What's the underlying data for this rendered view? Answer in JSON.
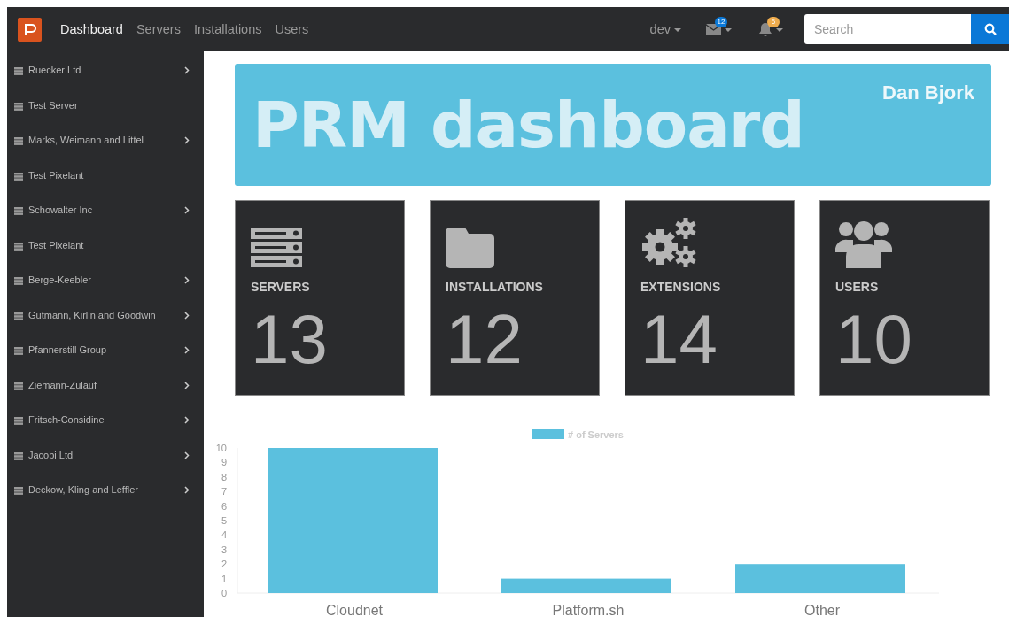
{
  "navbar": {
    "nav_items": [
      {
        "label": "Dashboard",
        "selected": true
      },
      {
        "label": "Servers",
        "selected": false
      },
      {
        "label": "Installations",
        "selected": false
      },
      {
        "label": "Users",
        "selected": false
      }
    ],
    "user_menu": "dev",
    "messages_badge": "12",
    "notifications_badge": "6",
    "search": {
      "placeholder": "Search"
    }
  },
  "sidebar": {
    "items": [
      {
        "label": "Ruecker Ltd",
        "expandable": true
      },
      {
        "label": "Test Server",
        "expandable": false
      },
      {
        "label": "Marks, Weimann and Littel",
        "expandable": true
      },
      {
        "label": "Test Pixelant",
        "expandable": false
      },
      {
        "label": "Schowalter Inc",
        "expandable": true
      },
      {
        "label": "Test Pixelant",
        "expandable": false
      },
      {
        "label": "Berge-Keebler",
        "expandable": true
      },
      {
        "label": "Gutmann, Kirlin and Goodwin",
        "expandable": true
      },
      {
        "label": "Pfannerstill Group",
        "expandable": true
      },
      {
        "label": "Ziemann-Zulauf",
        "expandable": true
      },
      {
        "label": "Fritsch-Considine",
        "expandable": true
      },
      {
        "label": "Jacobi Ltd",
        "expandable": true
      },
      {
        "label": "Deckow, Kling and Leffler",
        "expandable": true
      }
    ]
  },
  "banner": {
    "title": "PRM dashboard",
    "user_name": "Dan Bjork"
  },
  "stats": [
    {
      "kind": "servers",
      "label": "SERVERS",
      "value": "13"
    },
    {
      "kind": "installations",
      "label": "INSTALLATIONS",
      "value": "12"
    },
    {
      "kind": "extensions",
      "label": "EXTENSIONS",
      "value": "14"
    },
    {
      "kind": "users",
      "label": "USERS",
      "value": "10"
    }
  ],
  "chart": {
    "chart_data": {
      "type": "bar",
      "categories": [
        "Cloudnet",
        "Platform.sh",
        "Other"
      ],
      "series": [
        {
          "name": "# of Servers",
          "color": "#5bc0de",
          "values": [
            10,
            1,
            2
          ]
        }
      ],
      "ylim": [
        0,
        10
      ],
      "yticks": [
        0,
        1,
        2,
        3,
        4,
        5,
        6,
        7,
        8,
        9,
        10
      ]
    }
  }
}
